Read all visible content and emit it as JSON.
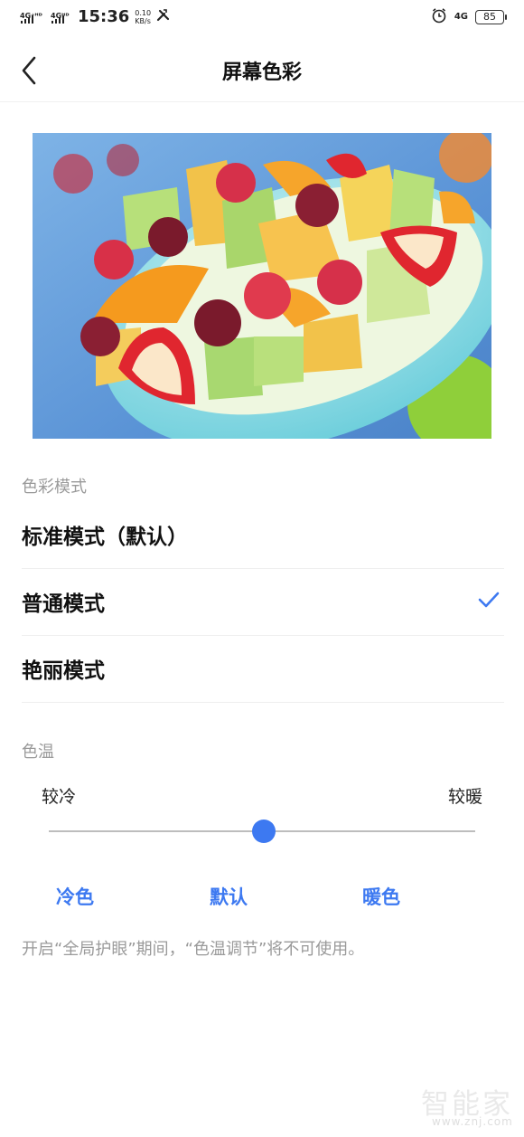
{
  "status_bar": {
    "signal1": "4G⁺ᴴᴰ",
    "signal2": "4Gᴴᴰ",
    "time": "15:36",
    "speed_value": "0.10",
    "speed_unit": "KB/s",
    "network": "4G",
    "battery": "85"
  },
  "header": {
    "title": "屏幕色彩"
  },
  "color_mode": {
    "section_title": "色彩模式",
    "options": [
      {
        "label": "标准模式（默认）",
        "selected": false
      },
      {
        "label": "普通模式",
        "selected": true
      },
      {
        "label": "艳丽模式",
        "selected": false
      }
    ]
  },
  "color_temp": {
    "section_title": "色温",
    "cool_label": "较冷",
    "warm_label": "较暖",
    "slider_value": 0.5,
    "presets": [
      "冷色",
      "默认",
      "暖色"
    ],
    "note": "开启“全局护眼”期间，“色温调节”将不可使用。"
  },
  "watermark": {
    "text": "智能家",
    "url": "www.znj.com"
  },
  "colors": {
    "accent": "#3d79f1",
    "secondary_text": "#9a9a9a"
  }
}
